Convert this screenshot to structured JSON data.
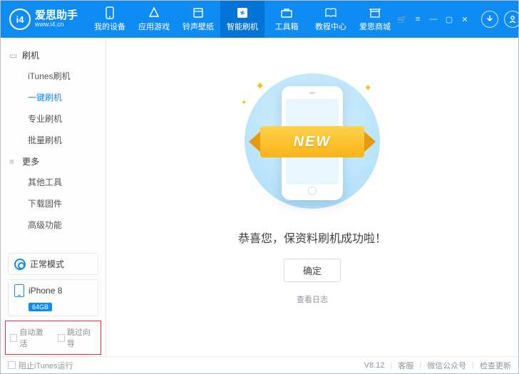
{
  "brand": {
    "name": "爱思助手",
    "site": "www.i4.cn",
    "logo_text": "i4"
  },
  "header_tabs": [
    {
      "label": "我的设备"
    },
    {
      "label": "应用游戏"
    },
    {
      "label": "铃声壁纸"
    },
    {
      "label": "智能刷机",
      "active": true
    },
    {
      "label": "工具箱"
    },
    {
      "label": "教程中心"
    },
    {
      "label": "爱思商城"
    }
  ],
  "sidebar": {
    "groups": [
      {
        "title": "刷机",
        "icon": "phone",
        "items": [
          {
            "label": "iTunes刷机"
          },
          {
            "label": "一键刷机",
            "active": true
          },
          {
            "label": "专业刷机"
          },
          {
            "label": "批量刷机"
          }
        ]
      },
      {
        "title": "更多",
        "icon": "list",
        "items": [
          {
            "label": "其他工具"
          },
          {
            "label": "下载固件"
          },
          {
            "label": "高级功能"
          }
        ]
      }
    ],
    "mode": "正常模式",
    "device": {
      "name": "iPhone 8",
      "capacity": "64GB"
    },
    "auto_activate": "自动激活",
    "skip_guide": "跳过向导"
  },
  "main": {
    "ribbon": "NEW",
    "success": "恭喜您，保资料刷机成功啦！",
    "ok": "确定",
    "view_log": "查看日志"
  },
  "footer": {
    "block_itunes": "阻止iTunes运行",
    "version": "V8.12",
    "support": "客服",
    "wechat": "微信公众号",
    "check_update": "检查更新"
  }
}
